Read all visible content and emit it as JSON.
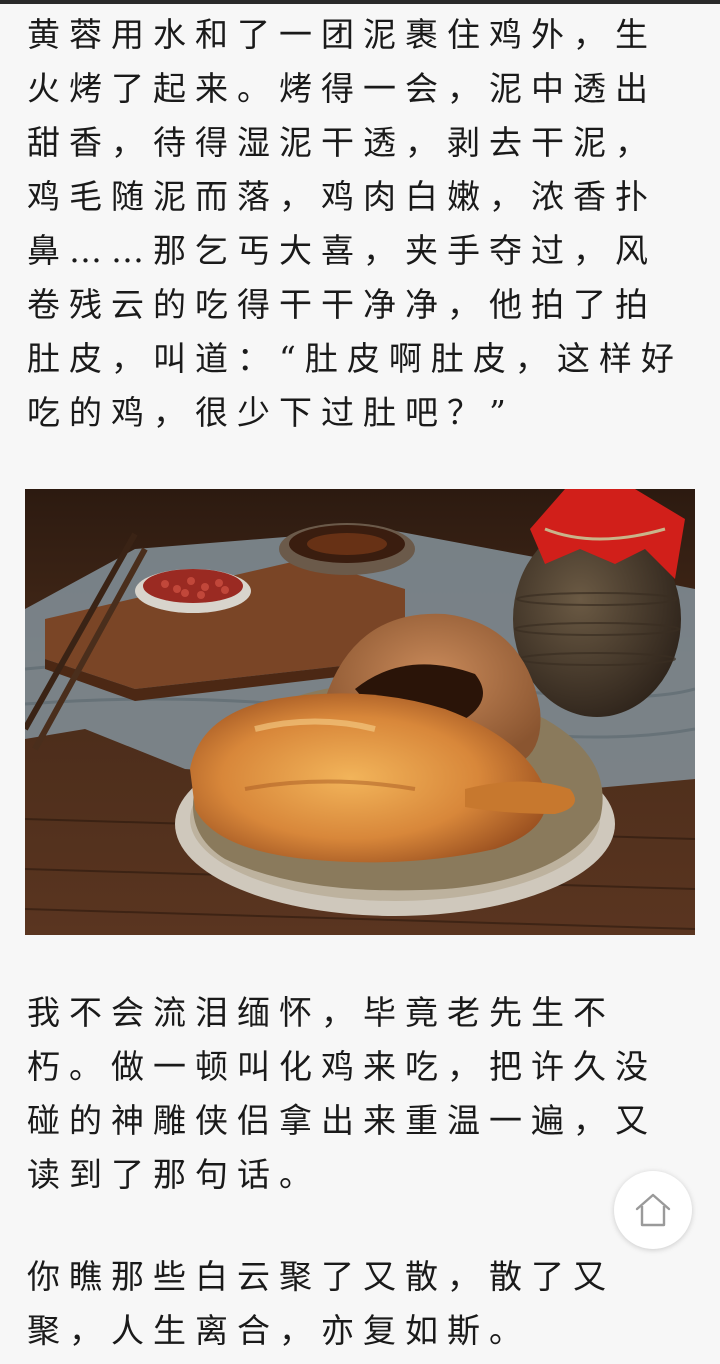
{
  "article": {
    "paragraph_1": "黄蓉用水和了一团泥裹住鸡外，生火烤了起来。烤得一会，泥中透出甜香，待得湿泥干透，剥去干泥，鸡毛随泥而落，鸡肉白嫩，浓香扑鼻……那乞丐大喜，夹手夺过，风卷残云的吃得干干净净，他拍了拍肚皮，叫道：“肚皮啊肚皮，这样好吃的鸡，很少下过肚吧？”",
    "paragraph_2": "我不会流泪缅怀，毕竟老先生不朽。做一顿叫化鸡来吃，把许久没碰的神雕侠侣拿出来重温一遍，又读到了那句话。",
    "paragraph_3": "你瞧那些白云聚了又散，散了又聚，人生离合，亦复如斯。"
  },
  "photo": {
    "subject": "beggar's chicken (叫化鸡) on lotus leaf with clay crust, wine jar, chopsticks, red beans"
  },
  "icons": {
    "home": "home-icon"
  },
  "colors": {
    "background": "#f7f7f7",
    "text": "#1a1a1a"
  }
}
